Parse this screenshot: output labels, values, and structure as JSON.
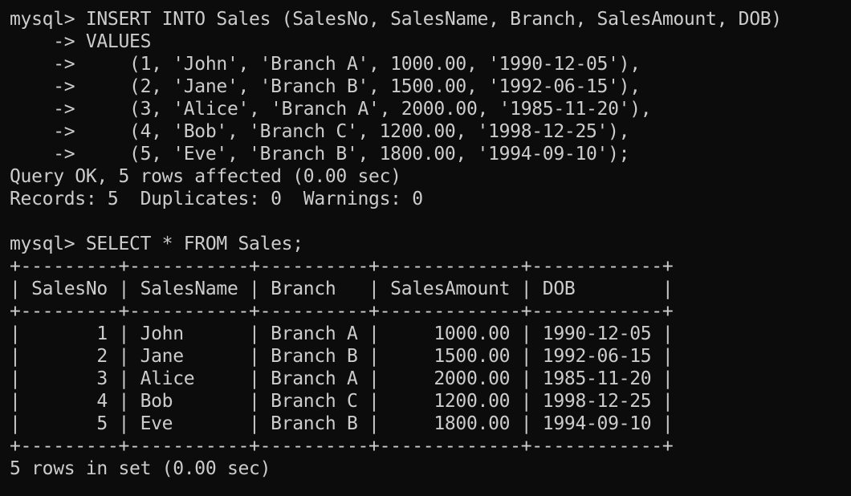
{
  "terminal": {
    "lines": [
      "mysql> INSERT INTO Sales (SalesNo, SalesName, Branch, SalesAmount, DOB)",
      "    -> VALUES",
      "    ->     (1, 'John', 'Branch A', 1000.00, '1990-12-05'),",
      "    ->     (2, 'Jane', 'Branch B', 1500.00, '1992-06-15'),",
      "    ->     (3, 'Alice', 'Branch A', 2000.00, '1985-11-20'),",
      "    ->     (4, 'Bob', 'Branch C', 1200.00, '1998-12-25'),",
      "    ->     (5, 'Eve', 'Branch B', 1800.00, '1994-09-10');",
      "Query OK, 5 rows affected (0.00 sec)",
      "Records: 5  Duplicates: 0  Warnings: 0",
      "",
      "mysql> SELECT * FROM Sales;",
      "+---------+-----------+----------+-------------+------------+",
      "| SalesNo | SalesName | Branch   | SalesAmount | DOB        |",
      "+---------+-----------+----------+-------------+------------+",
      "|       1 | John      | Branch A |     1000.00 | 1990-12-05 |",
      "|       2 | Jane      | Branch B |     1500.00 | 1992-06-15 |",
      "|       3 | Alice     | Branch A |     2000.00 | 1985-11-20 |",
      "|       4 | Bob       | Branch C |     1200.00 | 1998-12-25 |",
      "|       5 | Eve       | Branch B |     1800.00 | 1994-09-10 |",
      "+---------+-----------+----------+-------------+------------+",
      "5 rows in set (0.00 sec)"
    ]
  },
  "colors": {
    "background": "#0c0c0c",
    "text": "#cccccc"
  }
}
